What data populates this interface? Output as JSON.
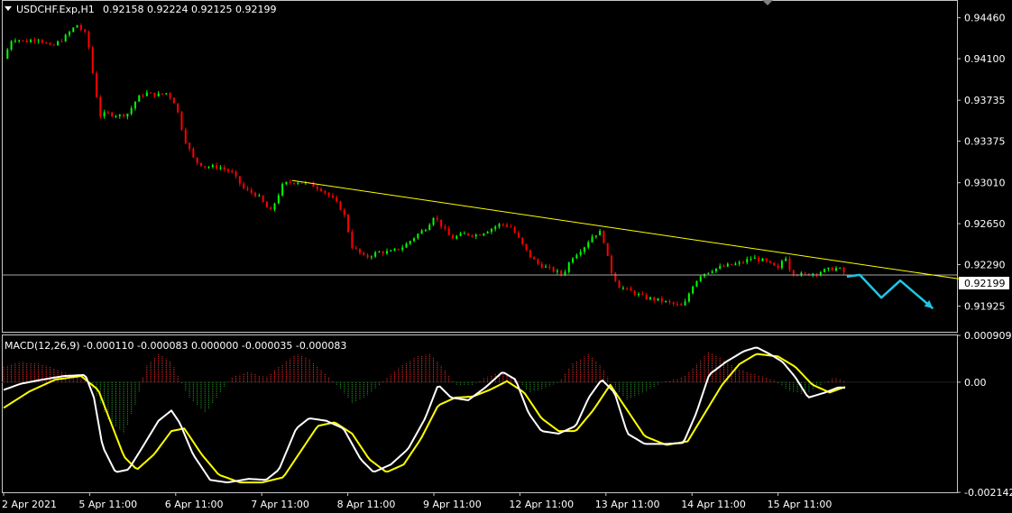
{
  "colors": {
    "background": "#000000",
    "bull_candle": "#00ff00",
    "bear_candle": "#ff0000",
    "trendline": "#ffff00",
    "arrow": "#1fc6e6",
    "macd_line": "#ffffff",
    "signal_line": "#ffff00",
    "hist_positive": "#ff3030",
    "hist_negative": "#2aa02a",
    "bid_line": "#a9a9a9",
    "grid_frame": "#c8c8c8"
  },
  "header": {
    "symbol_label": "USDCHF.Exp,H1",
    "ohlc_label": "0.92158 0.92224 0.92125 0.92199",
    "menu_icon": "triangle-down-icon"
  },
  "macd_header": {
    "label": "MACD(12,26,9) -0.000110 -0.000083 0.000000 -0.000035 -0.000083"
  },
  "current_price": "0.92199",
  "chart_data": [
    {
      "type": "candlestick",
      "title": "USDCHF.Exp,H1",
      "price_axis": {
        "ylim": [
          0.917,
          0.946
        ],
        "ticks": [
          "0.94460",
          "0.94100",
          "0.93735",
          "0.93375",
          "0.93010",
          "0.92650",
          "0.92290",
          "0.91925"
        ]
      },
      "time_axis": {
        "ticks": [
          "2 Apr 2021",
          "5 Apr 11:00",
          "6 Apr 11:00",
          "7 Apr 11:00",
          "8 Apr 11:00",
          "9 Apr 11:00",
          "12 Apr 11:00",
          "13 Apr 11:00",
          "14 Apr 11:00",
          "15 Apr 11:00"
        ]
      },
      "close_path": [
        {
          "day": 0.0,
          "close": 0.941
        },
        {
          "day": 0.1,
          "close": 0.9428
        },
        {
          "day": 0.25,
          "close": 0.9425
        },
        {
          "day": 0.4,
          "close": 0.9428
        },
        {
          "day": 0.55,
          "close": 0.942
        },
        {
          "day": 0.7,
          "close": 0.9428
        },
        {
          "day": 0.85,
          "close": 0.944
        },
        {
          "day": 0.97,
          "close": 0.943
        },
        {
          "day": 1.05,
          "close": 0.939
        },
        {
          "day": 1.12,
          "close": 0.936
        },
        {
          "day": 1.2,
          "close": 0.9362
        },
        {
          "day": 1.35,
          "close": 0.936
        },
        {
          "day": 1.45,
          "close": 0.9362
        },
        {
          "day": 1.55,
          "close": 0.9375
        },
        {
          "day": 1.65,
          "close": 0.938
        },
        {
          "day": 1.78,
          "close": 0.9378
        },
        {
          "day": 1.9,
          "close": 0.938
        },
        {
          "day": 2.0,
          "close": 0.937
        },
        {
          "day": 2.1,
          "close": 0.934
        },
        {
          "day": 2.22,
          "close": 0.932
        },
        {
          "day": 2.35,
          "close": 0.9315
        },
        {
          "day": 2.5,
          "close": 0.9315
        },
        {
          "day": 2.65,
          "close": 0.931
        },
        {
          "day": 2.8,
          "close": 0.9295
        },
        {
          "day": 2.95,
          "close": 0.929
        },
        {
          "day": 3.1,
          "close": 0.9275
        },
        {
          "day": 3.25,
          "close": 0.93
        },
        {
          "day": 3.4,
          "close": 0.9302
        },
        {
          "day": 3.55,
          "close": 0.93
        },
        {
          "day": 3.7,
          "close": 0.9295
        },
        {
          "day": 3.85,
          "close": 0.9285
        },
        {
          "day": 3.95,
          "close": 0.9275
        },
        {
          "day": 4.05,
          "close": 0.9245
        },
        {
          "day": 4.2,
          "close": 0.9235
        },
        {
          "day": 4.35,
          "close": 0.924
        },
        {
          "day": 4.5,
          "close": 0.924
        },
        {
          "day": 4.65,
          "close": 0.9245
        },
        {
          "day": 4.8,
          "close": 0.9255
        },
        {
          "day": 4.92,
          "close": 0.9262
        },
        {
          "day": 5.0,
          "close": 0.9272
        },
        {
          "day": 5.1,
          "close": 0.9262
        },
        {
          "day": 5.2,
          "close": 0.9252
        },
        {
          "day": 5.35,
          "close": 0.9256
        },
        {
          "day": 5.5,
          "close": 0.9255
        },
        {
          "day": 5.65,
          "close": 0.926
        },
        {
          "day": 5.78,
          "close": 0.9265
        },
        {
          "day": 5.9,
          "close": 0.9262
        },
        {
          "day": 6.0,
          "close": 0.925
        },
        {
          "day": 6.1,
          "close": 0.9238
        },
        {
          "day": 6.2,
          "close": 0.923
        },
        {
          "day": 6.35,
          "close": 0.9225
        },
        {
          "day": 6.5,
          "close": 0.922
        },
        {
          "day": 6.6,
          "close": 0.9235
        },
        {
          "day": 6.75,
          "close": 0.9245
        },
        {
          "day": 6.85,
          "close": 0.9255
        },
        {
          "day": 6.95,
          "close": 0.9258
        },
        {
          "day": 7.05,
          "close": 0.9225
        },
        {
          "day": 7.15,
          "close": 0.921
        },
        {
          "day": 7.3,
          "close": 0.9205
        },
        {
          "day": 7.45,
          "close": 0.92
        },
        {
          "day": 7.6,
          "close": 0.9198
        },
        {
          "day": 7.75,
          "close": 0.9195
        },
        {
          "day": 7.9,
          "close": 0.9192
        },
        {
          "day": 8.0,
          "close": 0.921
        },
        {
          "day": 8.1,
          "close": 0.922
        },
        {
          "day": 8.25,
          "close": 0.9225
        },
        {
          "day": 8.4,
          "close": 0.9228
        },
        {
          "day": 8.55,
          "close": 0.923
        },
        {
          "day": 8.7,
          "close": 0.9235
        },
        {
          "day": 8.85,
          "close": 0.9232
        },
        {
          "day": 9.0,
          "close": 0.9225
        },
        {
          "day": 9.08,
          "close": 0.9238
        },
        {
          "day": 9.15,
          "close": 0.9222
        },
        {
          "day": 9.3,
          "close": 0.922
        },
        {
          "day": 9.45,
          "close": 0.9222
        },
        {
          "day": 9.6,
          "close": 0.9225
        },
        {
          "day": 9.7,
          "close": 0.9226
        },
        {
          "day": 9.8,
          "close": 0.922
        }
      ],
      "trendline": {
        "start": {
          "day": 3.35,
          "price": 0.9303
        },
        "end": {
          "day": 11.15,
          "price": 0.9216
        }
      },
      "projection_arrow": [
        {
          "day": 9.8,
          "price": 0.92185
        },
        {
          "day": 9.95,
          "price": 0.922
        },
        {
          "day": 10.2,
          "price": 0.92
        },
        {
          "day": 10.42,
          "price": 0.9215
        },
        {
          "day": 10.8,
          "price": 0.91905
        }
      ]
    },
    {
      "type": "macd",
      "title": "MACD(12,26,9)",
      "ylim": [
        -0.00214,
        0.00091
      ],
      "ticks": [
        "0.000909",
        "0.00",
        "-0.002142"
      ],
      "macd": [
        {
          "day": 0.0,
          "v": -0.00015
        },
        {
          "day": 0.2,
          "v": -3e-05
        },
        {
          "day": 0.45,
          "v": 5e-05
        },
        {
          "day": 0.7,
          "v": 0.00012
        },
        {
          "day": 0.95,
          "v": 0.00014
        },
        {
          "day": 1.05,
          "v": -0.0003
        },
        {
          "day": 1.15,
          "v": -0.00125
        },
        {
          "day": 1.3,
          "v": -0.00175
        },
        {
          "day": 1.45,
          "v": -0.0017
        },
        {
          "day": 1.6,
          "v": -0.0013
        },
        {
          "day": 1.8,
          "v": -0.00075
        },
        {
          "day": 1.95,
          "v": -0.00055
        },
        {
          "day": 2.05,
          "v": -0.0008
        },
        {
          "day": 2.2,
          "v": -0.0014
        },
        {
          "day": 2.4,
          "v": -0.0019
        },
        {
          "day": 2.6,
          "v": -0.00195
        },
        {
          "day": 2.85,
          "v": -0.00188
        },
        {
          "day": 3.05,
          "v": -0.0019
        },
        {
          "day": 3.2,
          "v": -0.0017
        },
        {
          "day": 3.4,
          "v": -0.0009
        },
        {
          "day": 3.55,
          "v": -0.0007
        },
        {
          "day": 3.75,
          "v": -0.00075
        },
        {
          "day": 3.95,
          "v": -0.0009
        },
        {
          "day": 4.15,
          "v": -0.0015
        },
        {
          "day": 4.3,
          "v": -0.00175
        },
        {
          "day": 4.5,
          "v": -0.0016
        },
        {
          "day": 4.7,
          "v": -0.0013
        },
        {
          "day": 4.9,
          "v": -0.0007
        },
        {
          "day": 5.05,
          "v": -5e-05
        },
        {
          "day": 5.2,
          "v": -0.0003
        },
        {
          "day": 5.4,
          "v": -0.00035
        },
        {
          "day": 5.6,
          "v": -0.0001
        },
        {
          "day": 5.8,
          "v": 0.0002
        },
        {
          "day": 5.95,
          "v": 5e-05
        },
        {
          "day": 6.1,
          "v": -0.0006
        },
        {
          "day": 6.25,
          "v": -0.00095
        },
        {
          "day": 6.45,
          "v": -0.001
        },
        {
          "day": 6.65,
          "v": -0.00085
        },
        {
          "day": 6.8,
          "v": -0.0003
        },
        {
          "day": 6.95,
          "v": 5e-05
        },
        {
          "day": 7.1,
          "v": -0.0002
        },
        {
          "day": 7.25,
          "v": -0.001
        },
        {
          "day": 7.45,
          "v": -0.0012
        },
        {
          "day": 7.7,
          "v": -0.0012
        },
        {
          "day": 7.9,
          "v": -0.00118
        },
        {
          "day": 8.05,
          "v": -0.0006
        },
        {
          "day": 8.2,
          "v": 0.00015
        },
        {
          "day": 8.4,
          "v": 0.0004
        },
        {
          "day": 8.6,
          "v": 0.0006
        },
        {
          "day": 8.75,
          "v": 0.00068
        },
        {
          "day": 8.9,
          "v": 0.00055
        },
        {
          "day": 9.05,
          "v": 0.0004
        },
        {
          "day": 9.2,
          "v": 0.0001
        },
        {
          "day": 9.35,
          "v": -0.0003
        },
        {
          "day": 9.55,
          "v": -0.0002
        },
        {
          "day": 9.7,
          "v": -0.0001
        },
        {
          "day": 9.8,
          "v": -0.00011
        }
      ],
      "signal": [
        {
          "day": 0.0,
          "v": -0.0005
        },
        {
          "day": 0.3,
          "v": -0.00018
        },
        {
          "day": 0.6,
          "v": 5e-05
        },
        {
          "day": 0.9,
          "v": 0.00012
        },
        {
          "day": 1.1,
          "v": -0.00015
        },
        {
          "day": 1.25,
          "v": -0.0008
        },
        {
          "day": 1.4,
          "v": -0.00145
        },
        {
          "day": 1.55,
          "v": -0.0017
        },
        {
          "day": 1.75,
          "v": -0.0014
        },
        {
          "day": 1.95,
          "v": -0.00095
        },
        {
          "day": 2.1,
          "v": -0.0009
        },
        {
          "day": 2.3,
          "v": -0.0014
        },
        {
          "day": 2.5,
          "v": -0.0018
        },
        {
          "day": 2.75,
          "v": -0.00195
        },
        {
          "day": 3.0,
          "v": -0.00195
        },
        {
          "day": 3.25,
          "v": -0.00185
        },
        {
          "day": 3.45,
          "v": -0.00135
        },
        {
          "day": 3.65,
          "v": -0.00085
        },
        {
          "day": 3.85,
          "v": -0.00078
        },
        {
          "day": 4.05,
          "v": -0.001
        },
        {
          "day": 4.25,
          "v": -0.0015
        },
        {
          "day": 4.45,
          "v": -0.00175
        },
        {
          "day": 4.65,
          "v": -0.0016
        },
        {
          "day": 4.85,
          "v": -0.0011
        },
        {
          "day": 5.05,
          "v": -0.00045
        },
        {
          "day": 5.25,
          "v": -0.0003
        },
        {
          "day": 5.45,
          "v": -0.00028
        },
        {
          "day": 5.65,
          "v": -0.00015
        },
        {
          "day": 5.85,
          "v": 2e-05
        },
        {
          "day": 6.05,
          "v": -0.0002
        },
        {
          "day": 6.25,
          "v": -0.0007
        },
        {
          "day": 6.45,
          "v": -0.00095
        },
        {
          "day": 6.65,
          "v": -0.00095
        },
        {
          "day": 6.85,
          "v": -0.00055
        },
        {
          "day": 7.05,
          "v": -5e-05
        },
        {
          "day": 7.25,
          "v": -0.00055
        },
        {
          "day": 7.45,
          "v": -0.00105
        },
        {
          "day": 7.7,
          "v": -0.00122
        },
        {
          "day": 7.95,
          "v": -0.00115
        },
        {
          "day": 8.15,
          "v": -0.0006
        },
        {
          "day": 8.35,
          "v": -5e-05
        },
        {
          "day": 8.55,
          "v": 0.00035
        },
        {
          "day": 8.75,
          "v": 0.00055
        },
        {
          "day": 9.0,
          "v": 0.0005
        },
        {
          "day": 9.2,
          "v": 0.0003
        },
        {
          "day": 9.4,
          "v": -5e-05
        },
        {
          "day": 9.6,
          "v": -0.0002
        },
        {
          "day": 9.8,
          "v": -8e-05
        }
      ],
      "histogram": [
        {
          "day": 0.0,
          "v": 0.0003
        },
        {
          "day": 0.2,
          "v": 0.0004
        },
        {
          "day": 0.45,
          "v": 0.00035
        },
        {
          "day": 0.7,
          "v": 0.0002
        },
        {
          "day": 0.95,
          "v": 5e-05
        },
        {
          "day": 1.05,
          "v": -0.00015
        },
        {
          "day": 1.2,
          "v": -0.0007
        },
        {
          "day": 1.4,
          "v": -0.001
        },
        {
          "day": 1.55,
          "v": -0.00035
        },
        {
          "day": 1.65,
          "v": 0.0003
        },
        {
          "day": 1.8,
          "v": 0.00055
        },
        {
          "day": 1.95,
          "v": 0.0004
        },
        {
          "day": 2.05,
          "v": 5e-05
        },
        {
          "day": 2.15,
          "v": -0.0003
        },
        {
          "day": 2.35,
          "v": -0.0006
        },
        {
          "day": 2.5,
          "v": -0.00025
        },
        {
          "day": 2.65,
          "v": 0.0001
        },
        {
          "day": 2.85,
          "v": 0.0002
        },
        {
          "day": 3.05,
          "v": 0.0001
        },
        {
          "day": 3.2,
          "v": 0.0003
        },
        {
          "day": 3.4,
          "v": 0.00055
        },
        {
          "day": 3.55,
          "v": 0.00045
        },
        {
          "day": 3.75,
          "v": 0.00015
        },
        {
          "day": 3.9,
          "v": -0.0001
        },
        {
          "day": 4.05,
          "v": -0.0004
        },
        {
          "day": 4.2,
          "v": -0.0003
        },
        {
          "day": 4.4,
          "v": 0.0
        },
        {
          "day": 4.6,
          "v": 0.0003
        },
        {
          "day": 4.8,
          "v": 0.0005
        },
        {
          "day": 4.95,
          "v": 0.00055
        },
        {
          "day": 5.1,
          "v": 0.0003
        },
        {
          "day": 5.25,
          "v": -5e-05
        },
        {
          "day": 5.45,
          "v": -5e-05
        },
        {
          "day": 5.6,
          "v": 0.0001
        },
        {
          "day": 5.8,
          "v": 0.0002
        },
        {
          "day": 5.95,
          "v": 0.0001
        },
        {
          "day": 6.1,
          "v": -0.0002
        },
        {
          "day": 6.25,
          "v": -0.00015
        },
        {
          "day": 6.45,
          "v": 0.0
        },
        {
          "day": 6.6,
          "v": 0.00035
        },
        {
          "day": 6.8,
          "v": 0.00055
        },
        {
          "day": 6.95,
          "v": 0.0003
        },
        {
          "day": 7.1,
          "v": -0.0001
        },
        {
          "day": 7.25,
          "v": -0.00035
        },
        {
          "day": 7.45,
          "v": -0.0002
        },
        {
          "day": 7.65,
          "v": 0.0
        },
        {
          "day": 7.9,
          "v": 0.0001
        },
        {
          "day": 8.05,
          "v": 0.00035
        },
        {
          "day": 8.2,
          "v": 0.0006
        },
        {
          "day": 8.35,
          "v": 0.00045
        },
        {
          "day": 8.55,
          "v": 0.00025
        },
        {
          "day": 8.75,
          "v": 0.00015
        },
        {
          "day": 8.95,
          "v": 5e-05
        },
        {
          "day": 9.1,
          "v": -0.00015
        },
        {
          "day": 9.3,
          "v": -0.00025
        },
        {
          "day": 9.5,
          "v": -5e-05
        },
        {
          "day": 9.65,
          "v": 0.0001
        },
        {
          "day": 9.8,
          "v": 0.0
        }
      ]
    }
  ]
}
